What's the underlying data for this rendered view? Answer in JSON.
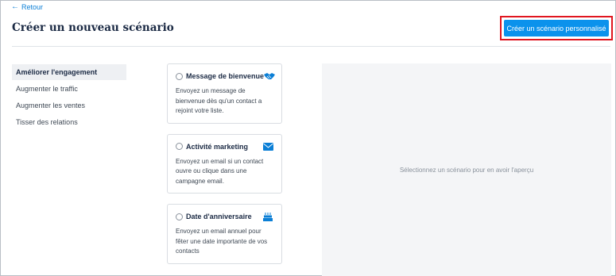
{
  "header": {
    "back_label": "Retour",
    "title": "Créer un nouveau scénario",
    "create_button": "Créer un scénario personnalisé"
  },
  "sidebar": {
    "items": [
      {
        "label": "Améliorer l'engagement",
        "active": true
      },
      {
        "label": "Augmenter le traffic",
        "active": false
      },
      {
        "label": "Augmenter les ventes",
        "active": false
      },
      {
        "label": "Tisser des relations",
        "active": false
      }
    ]
  },
  "cards": [
    {
      "title": "Message de bienvenue",
      "icon": "handshake-icon",
      "description": "Envoyez un message de bienvenue dès qu'un contact a rejoint votre liste."
    },
    {
      "title": "Activité marketing",
      "icon": "envelope-icon",
      "description": "Envoyez un email si un contact ouvre ou clique dans une campagne email."
    },
    {
      "title": "Date d'anniversaire",
      "icon": "cake-icon",
      "description": "Envoyez un email annuel pour fêter une date importante de vos contacts"
    }
  ],
  "preview": {
    "placeholder": "Sélectionnez un scénario pour en avoir l'aperçu"
  },
  "colors": {
    "accent": "#0b92ec",
    "highlight_border": "#e0161f",
    "title": "#1b2a44"
  }
}
